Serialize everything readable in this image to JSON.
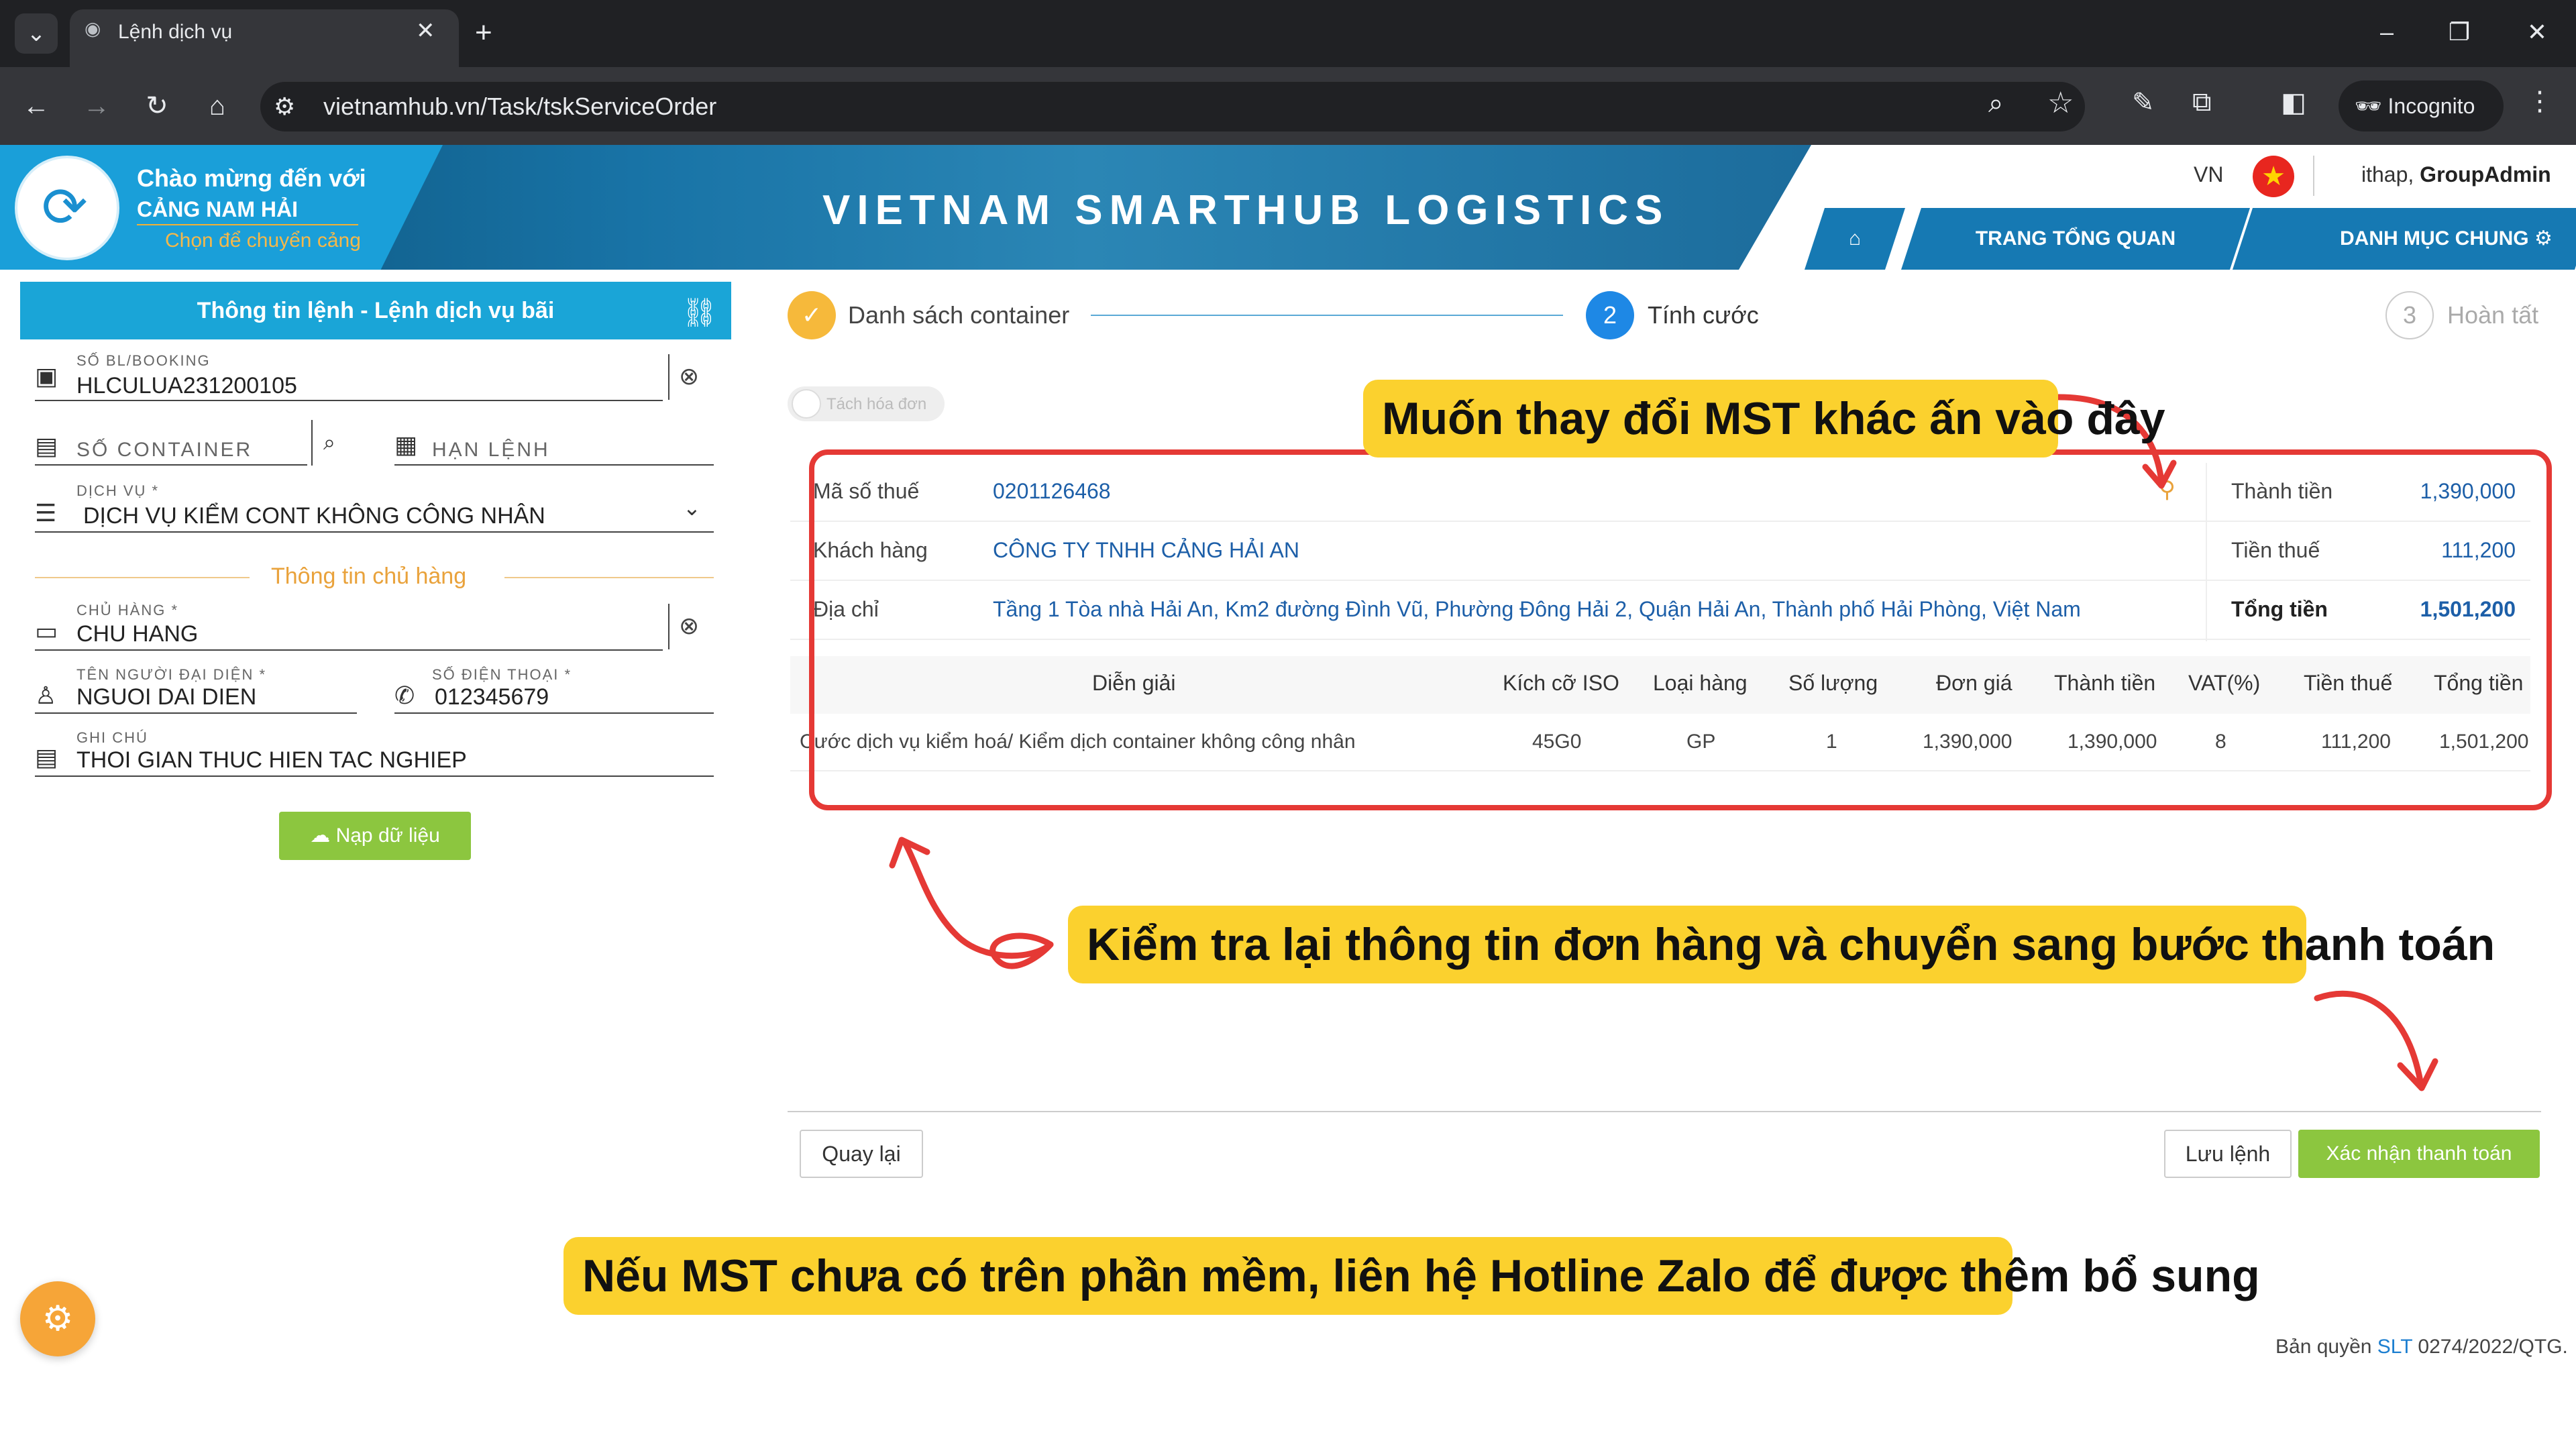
{
  "browser": {
    "tab_title": "Lệnh dịch vụ",
    "url": "vietnamhub.vn/Task/tskServiceOrder",
    "incognito_label": "Incognito"
  },
  "header": {
    "welcome": "Chào mừng đến với",
    "port_name": "CẢNG NAM HẢI",
    "change_port": "Chọn để chuyển cảng",
    "brand": "VIETNAM SMARTHUB LOGISTICS",
    "lang": "VN",
    "user_prefix": "ithap, ",
    "user_role": "GroupAdmin",
    "nav": {
      "overview": "TRANG TỔNG QUAN",
      "catalog": "DANH MỤC CHUNG"
    }
  },
  "left_panel": {
    "title": "Thông tin lệnh - Lệnh dịch vụ bãi",
    "bl_label": "SỐ BL/BOOKING",
    "bl_value": "HLCULUA231200105",
    "container_placeholder": "SỐ CONTAINER",
    "deadline_placeholder": "HẠN LỆNH",
    "service_label": "DỊCH VỤ *",
    "service_value": "DỊCH VỤ KIỂM CONT KHÔNG CÔNG NHÂN",
    "owner_section": "Thông tin chủ hàng",
    "owner_label": "CHỦ HÀNG *",
    "owner_value": "CHU HANG",
    "rep_label": "TÊN NGƯỜI ĐẠI DIỆN *",
    "rep_value": "NGUOI DAI DIEN",
    "phone_label": "SỐ ĐIỆN THOẠI *",
    "phone_value": "012345679",
    "note_label": "GHI CHÚ",
    "note_value": "THOI GIAN THUC HIEN TAC NGHIEP",
    "load_button": "Nạp dữ liệu"
  },
  "steps": [
    {
      "label": "Danh sách container",
      "status": "done"
    },
    {
      "number": "2",
      "label": "Tính cước",
      "status": "active"
    },
    {
      "number": "3",
      "label": "Hoàn tất",
      "status": "pending"
    }
  ],
  "invoice_toggle": "Tách hóa đơn",
  "order_info": {
    "tax_code_label": "Mã số thuế",
    "tax_code": "0201126468",
    "customer_label": "Khách hàng",
    "customer": "CÔNG TY TNHH CẢNG HẢI AN",
    "address_label": "Địa chỉ",
    "address": "Tầng 1 Tòa nhà Hải An, Km2 đường Đình Vũ, Phường Đông Hải 2, Quận Hải An, Thành phố Hải Phòng, Việt Nam",
    "subtotal_label": "Thành tiền",
    "subtotal": "1,390,000",
    "tax_label": "Tiền thuế",
    "tax": "111,200",
    "total_label": "Tổng tiền",
    "total": "1,501,200"
  },
  "table": {
    "headers": [
      "Diễn giải",
      "Kích cỡ ISO",
      "Loại hàng",
      "Số lượng",
      "Đơn giá",
      "Thành tiền",
      "VAT(%)",
      "Tiền thuế",
      "Tổng tiền"
    ],
    "rows": [
      [
        "Cước dịch vụ kiểm hoá/ Kiểm dịch container không công nhân",
        "45G0",
        "GP",
        "1",
        "1,390,000",
        "1,390,000",
        "8",
        "111,200",
        "1,501,200"
      ]
    ]
  },
  "buttons": {
    "back": "Quay lại",
    "save": "Lưu lệnh",
    "confirm": "Xác nhận thanh toán"
  },
  "annotations": {
    "change_tax": "Muốn thay đổi MST khác ấn vào đây",
    "review": "Kiểm tra lại thông tin đơn hàng và chuyển sang bước thanh toán",
    "hotline": "Nếu MST chưa có trên phần mềm, liên hệ Hotline Zalo để được thêm bổ sung"
  },
  "footer": {
    "copyright_prefix": "Bản quyền ",
    "copyright_brand": "SLT",
    "copyright_suffix": " 0274/2022/QTG."
  },
  "colors": {
    "header_blue": "#1aa5d7",
    "nav_blue": "#1679b3",
    "accent_green": "#8cc63f",
    "accent_orange": "#e9a23b",
    "annotation_red": "#e53935",
    "annotation_yellow": "#fbd12e",
    "link_blue": "#1d5fa8"
  }
}
